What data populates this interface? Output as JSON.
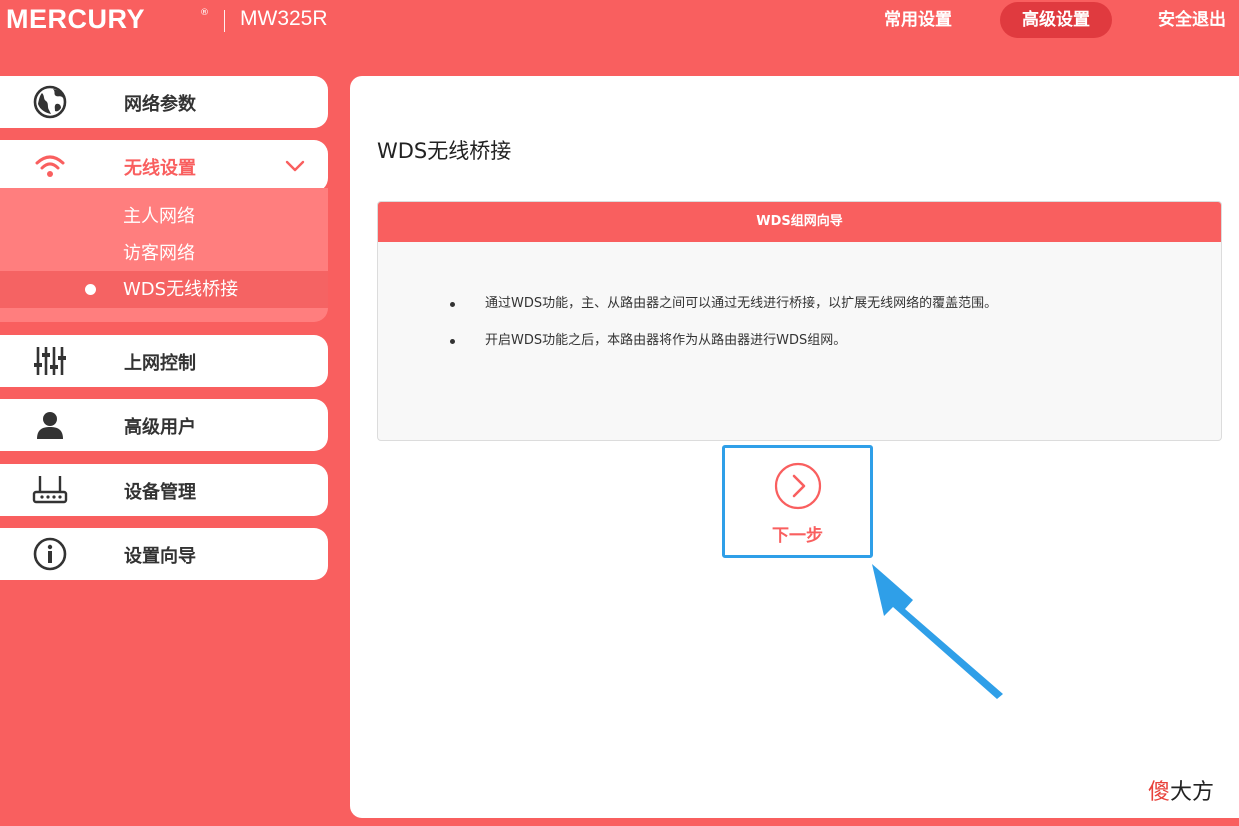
{
  "header": {
    "brand": "MERCURY",
    "brand_mark": "®",
    "model": "MW325R",
    "nav": {
      "common": "常用设置",
      "advanced": "高级设置",
      "logout": "安全退出"
    }
  },
  "sidebar": {
    "items": [
      {
        "label": "网络参数",
        "icon": "globe-icon"
      },
      {
        "label": "无线设置",
        "icon": "wifi-icon",
        "expanded": true
      },
      {
        "label": "上网控制",
        "icon": "sliders-icon"
      },
      {
        "label": "高级用户",
        "icon": "user-icon"
      },
      {
        "label": "设备管理",
        "icon": "router-icon"
      },
      {
        "label": "设置向导",
        "icon": "info-icon"
      }
    ],
    "wireless_sub": [
      {
        "label": "主人网络"
      },
      {
        "label": "访客网络"
      },
      {
        "label": "WDS无线桥接",
        "active": true
      }
    ]
  },
  "main": {
    "title": "WDS无线桥接",
    "wizard": {
      "header": "WDS组网向导",
      "bullets": [
        "通过WDS功能，主、从路由器之间可以通过无线进行桥接，以扩展无线网络的覆盖范围。",
        "开启WDS功能之后，本路由器将作为从路由器进行WDS组网。"
      ]
    },
    "next_button": "下一步"
  },
  "watermark": {
    "first": "傻",
    "rest": "大方"
  },
  "colors": {
    "primary": "#f95f5f",
    "header_active": "#e03a3f",
    "submenu_bg": "#ff7e7e",
    "highlight_blue": "#2f9fe8"
  }
}
